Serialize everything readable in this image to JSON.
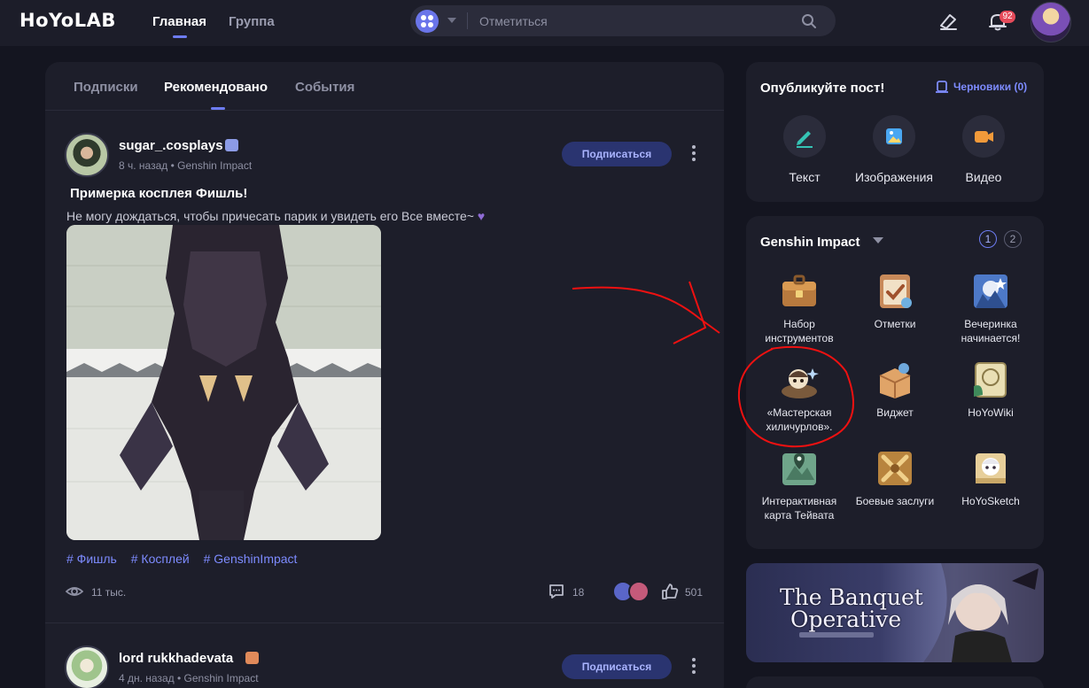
{
  "brand": {
    "logo": "HoYoLAB",
    "accent": "#6d7cf2"
  },
  "nav": {
    "items": [
      {
        "label": "Главная",
        "active": true
      },
      {
        "label": "Группа",
        "active": false
      }
    ]
  },
  "search": {
    "placeholder": "Отметиться"
  },
  "notifications": {
    "count": "92"
  },
  "feed": {
    "tabs": [
      {
        "label": "Подписки",
        "active": false
      },
      {
        "label": "Рекомендовано",
        "active": true
      },
      {
        "label": "События",
        "active": false
      }
    ],
    "posts": [
      {
        "author": "sugar_.cosplays",
        "meta": "8 ч. назад • Genshin Impact",
        "follow_label": "Подписаться",
        "title": "Примерка косплея Фишль!",
        "text": "Не могу дождаться, чтобы причесать парик и увидеть его Все вместе~",
        "tags": [
          "# Фишль",
          "# Косплей",
          "# GenshinImpact"
        ],
        "views": "11 тыс.",
        "comments": "18",
        "likes": "501"
      },
      {
        "author": "lord rukkhadevata",
        "meta": "4 дн. назад • Genshin Impact",
        "follow_label": "Подписаться"
      }
    ]
  },
  "publish": {
    "title": "Опубликуйте пост!",
    "drafts_label": "Черновики (0)",
    "options": [
      {
        "label": "Текст",
        "icon": "pen-icon",
        "color": "#35c3b4"
      },
      {
        "label": "Изображения",
        "icon": "image-icon",
        "color": "#4aa7f2"
      },
      {
        "label": "Видео",
        "icon": "video-icon",
        "color": "#f29a3a"
      }
    ]
  },
  "tools": {
    "title": "Genshin Impact",
    "pages": [
      "1",
      "2"
    ],
    "current_page": "1",
    "items": [
      {
        "label": "Набор инструментов",
        "icon": "toolbox-icon"
      },
      {
        "label": "Отметки",
        "icon": "check-in-icon"
      },
      {
        "label": "Вечеринка начинается!",
        "icon": "party-icon"
      },
      {
        "label": "«Мастерская хиличурлов».",
        "icon": "hilichurl-workshop-icon"
      },
      {
        "label": "Виджет",
        "icon": "widget-icon"
      },
      {
        "label": "HoYoWiki",
        "icon": "wiki-icon"
      },
      {
        "label": "Интерактивная карта Тейвата",
        "icon": "map-icon"
      },
      {
        "label": "Боевые заслуги",
        "icon": "battle-chronicle-icon"
      },
      {
        "label": "HoYoSketch",
        "icon": "sketch-icon"
      }
    ]
  },
  "banner": {
    "title_line1": "The Banquet",
    "title_line2": "Operative"
  }
}
